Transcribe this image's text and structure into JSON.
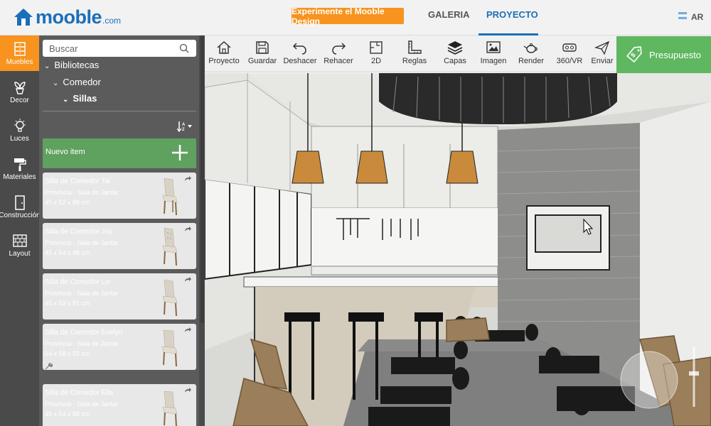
{
  "header": {
    "logo_text": "mooble",
    "logo_suffix": ".com",
    "cta_label": "Experimente el Mooble Design",
    "nav": [
      {
        "label": "GALERIA",
        "active": false
      },
      {
        "label": "PROYECTO",
        "active": true
      }
    ],
    "language": "AR",
    "accent_color": "#1b6fb8",
    "cta_color": "#f7931e"
  },
  "categories": [
    {
      "label": "Muebles",
      "icon": "cabinet-icon",
      "active": true
    },
    {
      "label": "Decor",
      "icon": "plant-icon",
      "active": false
    },
    {
      "label": "Luces",
      "icon": "bulb-icon",
      "active": false
    },
    {
      "label": "Materiales",
      "icon": "paint-roller-icon",
      "active": false
    },
    {
      "label": "Construcción",
      "icon": "door-icon",
      "active": false
    },
    {
      "label": "Layout",
      "icon": "brick-wall-icon",
      "active": false
    }
  ],
  "library": {
    "search_placeholder": "Buscar",
    "tree": [
      {
        "label": "Bibliotecas",
        "level": 0
      },
      {
        "label": "Comedor",
        "level": 1
      },
      {
        "label": "Sillas",
        "level": 2
      }
    ],
    "new_item_label": "Nuevo item",
    "items": [
      {
        "name": "Silla de Comedor Tai",
        "brand": "Província - Sala de Jantar",
        "dims": "45 x 52 x 89 cm"
      },
      {
        "name": "Silla de Comedor Joy",
        "brand": "Província - Sala de Jantar",
        "dims": "45 x 54 x 98 cm"
      },
      {
        "name": "Silla de Comedor Liv",
        "brand": "Província - Sala de Jantar",
        "dims": "45 x 53 x 91 cm"
      },
      {
        "name": "Silla de Comedor Evelyn",
        "brand": "Província - Sala de Jantar",
        "dims": "54 x 58 x 93 cm"
      },
      {
        "name": "Silla de Comedor Ella",
        "brand": "Província - Sala de Jantar",
        "dims": "45 x 54 x 88 cm"
      }
    ]
  },
  "toolbar": {
    "tools": [
      {
        "label": "Proyecto",
        "icon": "home-icon"
      },
      {
        "label": "Guardar",
        "icon": "save-icon"
      },
      {
        "label": "Deshacer",
        "icon": "undo-icon"
      },
      {
        "label": "Rehacer",
        "icon": "redo-icon"
      },
      {
        "label": "2D",
        "icon": "floorplan-icon"
      },
      {
        "label": "Reglas",
        "icon": "ruler-icon"
      },
      {
        "label": "Capas",
        "icon": "layers-icon"
      },
      {
        "label": "Imagen",
        "icon": "image-icon"
      },
      {
        "label": "Render",
        "icon": "teapot-icon"
      },
      {
        "label": "360/VR",
        "icon": "vr-icon"
      },
      {
        "label": "Enviar",
        "icon": "send-icon"
      }
    ],
    "budget_label": "Presupuesto",
    "budget_color": "#5fb760"
  }
}
